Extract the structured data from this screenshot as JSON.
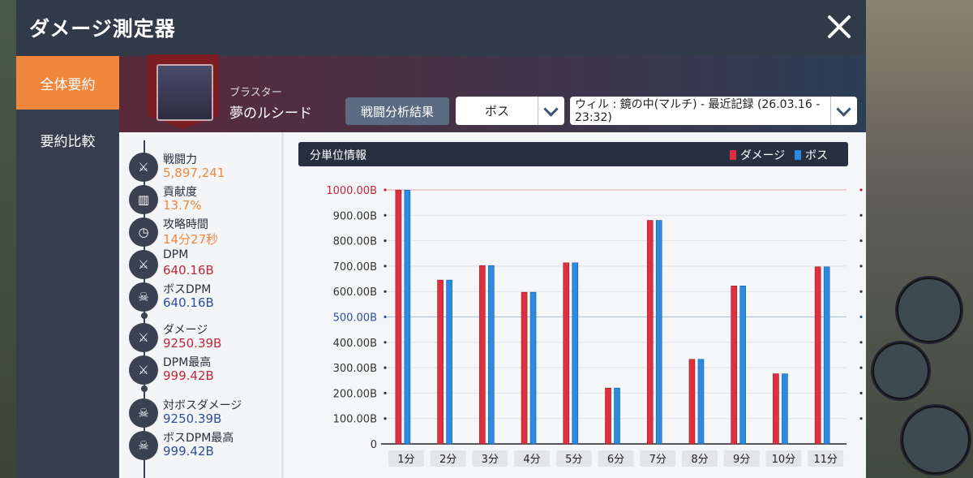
{
  "window": {
    "title": "ダメージ測定器"
  },
  "sidebar": {
    "items": [
      {
        "label": "全体要約"
      },
      {
        "label": "要約比較"
      }
    ]
  },
  "character": {
    "job": "ブラスター",
    "name": "夢のルシード"
  },
  "header": {
    "analysis_button": "戦闘分析結果",
    "target_select": "ボス",
    "record_select": "ウィル : 鏡の中(マルチ) - 最近記録 (26.03.16 - 23:32)"
  },
  "stats": [
    {
      "label": "戦闘力",
      "value": "5,897,241",
      "color": "orange",
      "icon": "crossed-swords-icon",
      "glyph": "⚔"
    },
    {
      "label": "貢献度",
      "value": "13.7%",
      "color": "orange",
      "icon": "bar-chart-icon",
      "glyph": "▥"
    },
    {
      "label": "攻略時間",
      "value": "14分27秒",
      "color": "orange",
      "icon": "clock-icon",
      "glyph": "◷"
    },
    {
      "label": "DPM",
      "value": "640.16B",
      "color": "red",
      "icon": "sword-icon",
      "glyph": "⚔"
    },
    {
      "label": "ボスDPM",
      "value": "640.16B",
      "color": "blue",
      "icon": "skull-icon",
      "glyph": "☠"
    },
    {
      "label": "ダメージ",
      "value": "9250.39B",
      "color": "red",
      "icon": "sword-icon",
      "glyph": "⚔"
    },
    {
      "label": "DPM最高",
      "value": "999.42B",
      "color": "red",
      "icon": "sword-up-icon",
      "glyph": "⚔"
    },
    {
      "label": "対ボスダメージ",
      "value": "9250.39B",
      "color": "blue",
      "icon": "skull-icon",
      "glyph": "☠"
    },
    {
      "label": "ボスDPM最高",
      "value": "999.42B",
      "color": "blue",
      "icon": "skull-up-icon",
      "glyph": "☠"
    }
  ],
  "chart_header": {
    "title": "分単位情報",
    "legend": [
      "ダメージ",
      "ボス"
    ]
  },
  "colors": {
    "damage": "#e0303f",
    "boss": "#2a8be0",
    "accent": "#f0873d",
    "panel": "#313a49"
  },
  "chart_data": {
    "type": "bar",
    "title": "分単位情報",
    "categories": [
      "1分",
      "2分",
      "3分",
      "4分",
      "5分",
      "6分",
      "7分",
      "8分",
      "9分",
      "10分",
      "11分"
    ],
    "series": [
      {
        "name": "ダメージ",
        "values": [
          999,
          645,
          702,
          597,
          713,
          220,
          880,
          333,
          622,
          276,
          697
        ]
      },
      {
        "name": "ボス",
        "values": [
          999,
          645,
          702,
          597,
          713,
          220,
          880,
          333,
          622,
          276,
          697
        ]
      }
    ],
    "yticks": [
      "0",
      "100.00B",
      "200.00B",
      "300.00B",
      "400.00B",
      "500.00B",
      "600.00B",
      "700.00B",
      "800.00B",
      "900.00B",
      "1000.00B"
    ],
    "ylim": [
      0,
      1000
    ],
    "legend_position": "top-right",
    "grid": true
  }
}
